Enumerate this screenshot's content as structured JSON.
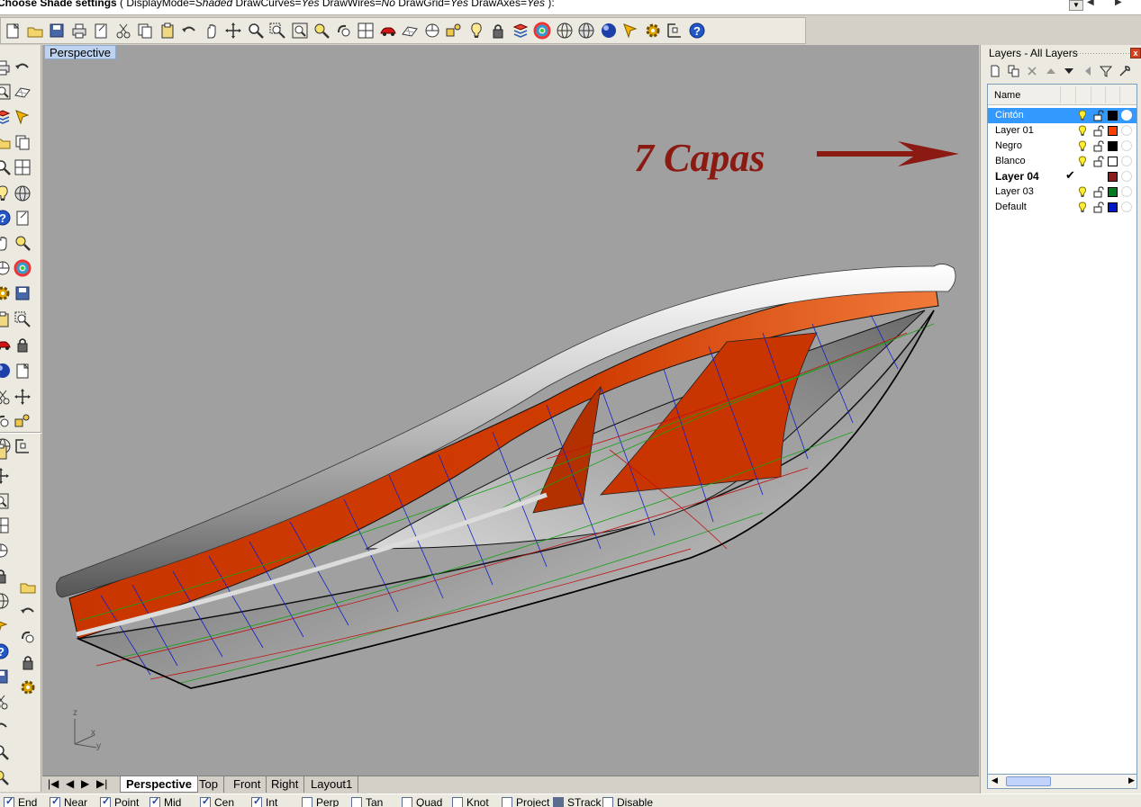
{
  "command_line": {
    "prompt": "Choose Shade settings",
    "open": "(",
    "opt1_key": "DisplayMode=",
    "opt1_val": "Shaded",
    "opt2_key": "DrawCurves=",
    "opt2_val": "Yes",
    "opt3_key": "DrawWires=",
    "opt3_val": "No",
    "opt4_key": "DrawGrid=",
    "opt4_val": "Yes",
    "opt5_key": "DrawAxes=",
    "opt5_val": "Yes",
    "close": "):"
  },
  "toolbar": {
    "icons": [
      "new-document-icon",
      "open-folder-icon",
      "save-icon",
      "print-icon",
      "import-icon",
      "cut-icon",
      "copy-icon",
      "paste-icon",
      "undo-icon",
      "pan-hand-icon",
      "rotate-view-icon",
      "zoom-icon",
      "zoom-window-icon",
      "zoom-extents-icon",
      "zoom-selected-icon",
      "undo-view-icon",
      "four-viewports-icon",
      "car-icon",
      "grid-plane-icon",
      "cplane-icon",
      "osnap-icon",
      "light-icon",
      "lock-icon",
      "layer-icon",
      "color-wheel-icon",
      "wireframe-sphere-icon",
      "ghosted-sphere-icon",
      "shaded-sphere-icon",
      "render-icon",
      "gear-icon",
      "gumball-icon",
      "help-icon"
    ]
  },
  "viewport": {
    "title": "Perspective",
    "annotation": "7 Capas",
    "axis_z": "z",
    "axis_x": "x",
    "axis_y": "y",
    "colors": {
      "background": "#a0a0a0",
      "hull_orange": "#cc3a00",
      "annotation": "#8b1a12"
    }
  },
  "view_tabs": {
    "tabs": [
      "Perspective",
      "Top",
      "Front",
      "Right",
      "Layout1"
    ],
    "active": "Perspective",
    "nav_first": "|◀",
    "nav_prev": "◀",
    "nav_next": "▶",
    "nav_last": "▶|"
  },
  "osnap": {
    "items": [
      {
        "label": "End",
        "checked": true
      },
      {
        "label": "Near",
        "checked": true
      },
      {
        "label": "Point",
        "checked": true
      },
      {
        "label": "Mid",
        "checked": true
      },
      {
        "label": "Cen",
        "checked": true
      },
      {
        "label": "Int",
        "checked": true
      },
      {
        "label": "Perp",
        "checked": false
      },
      {
        "label": "Tan",
        "checked": false
      },
      {
        "label": "Quad",
        "checked": false
      },
      {
        "label": "Knot",
        "checked": false
      },
      {
        "label": "Project",
        "checked": false
      },
      {
        "label": "STrack",
        "checked": true
      },
      {
        "label": "Disable",
        "checked": false
      }
    ]
  },
  "layers_panel": {
    "title": "Layers - All Layers",
    "column_name": "Name",
    "close_glyph": "x",
    "layers": [
      {
        "name": "Cintón",
        "color": "#000000",
        "selected": true,
        "current": false
      },
      {
        "name": "Layer 01",
        "color": "#ff4000",
        "selected": false,
        "current": false
      },
      {
        "name": "Negro",
        "color": "#000000",
        "selected": false,
        "current": false
      },
      {
        "name": "Blanco",
        "color": "#ffffff",
        "selected": false,
        "current": false
      },
      {
        "name": "Layer 04",
        "color": "#8b1a1a",
        "selected": false,
        "current": true
      },
      {
        "name": "Layer 03",
        "color": "#007a1e",
        "selected": false,
        "current": false
      },
      {
        "name": "Default",
        "color": "#0018c8",
        "selected": false,
        "current": false
      }
    ],
    "current_mark": "✔"
  }
}
